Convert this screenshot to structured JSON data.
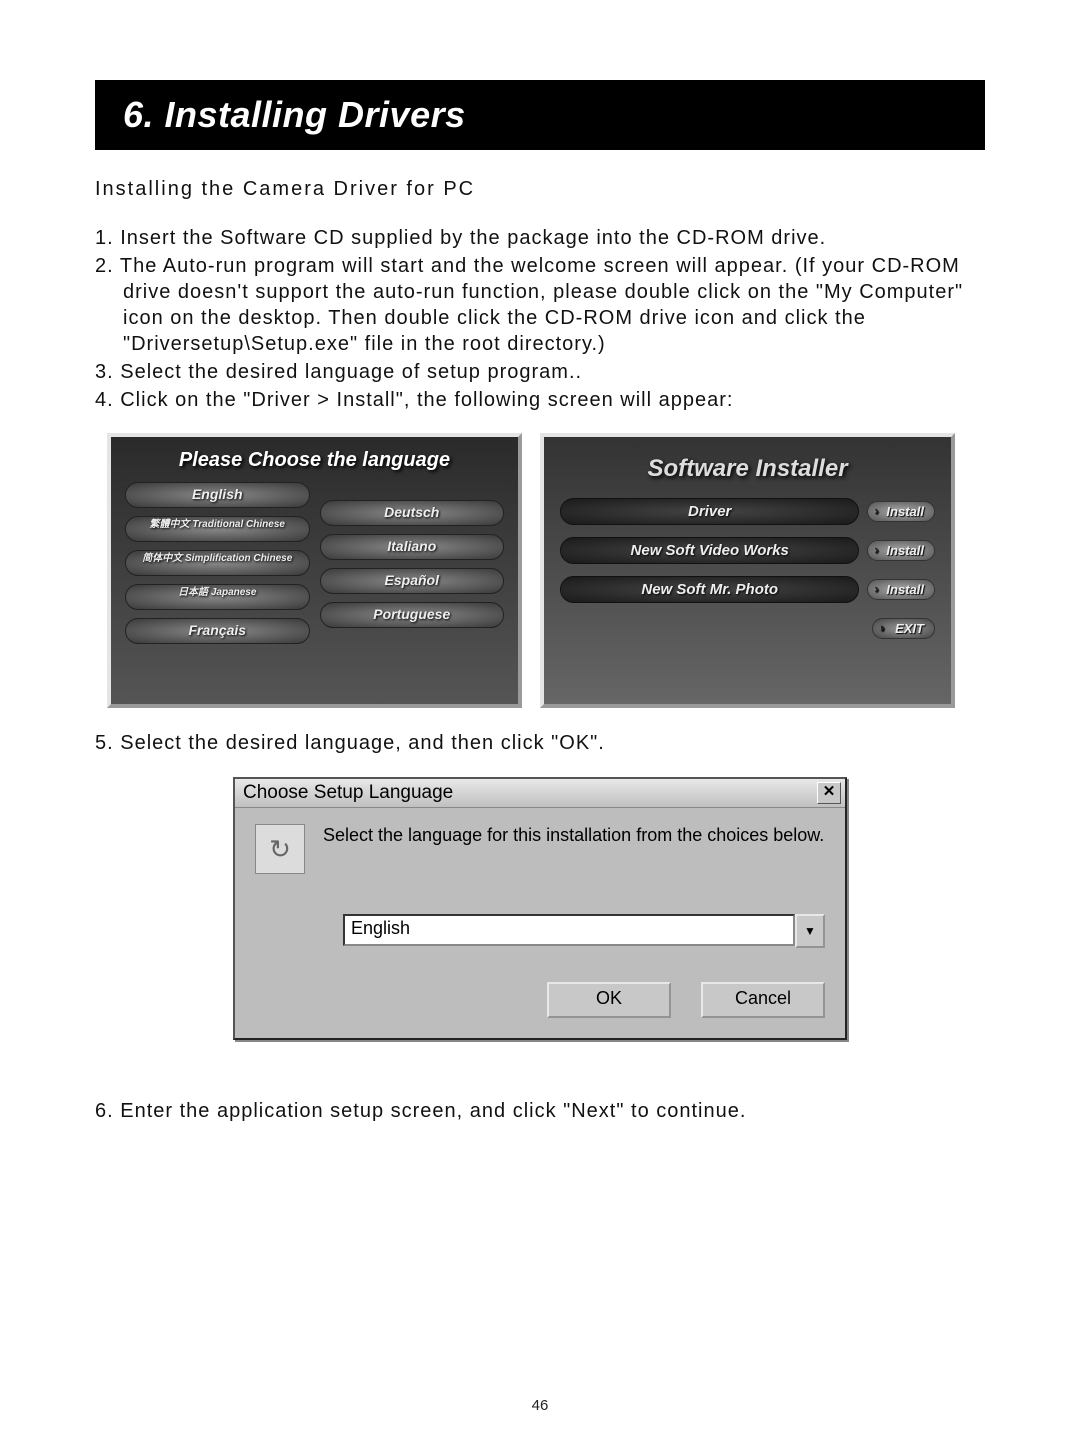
{
  "title": "6. Installing Drivers",
  "subheading": "Installing the Camera Driver for PC",
  "steps_1_4": [
    "1. Insert the Software CD supplied by the package into the CD-ROM drive.",
    "2. The Auto-run program will start and the welcome screen will appear. (If your CD-ROM drive doesn't support the auto-run function, please double click on the \"My Computer\" icon on the desktop. Then double click the CD-ROM drive icon and click the \"Driversetup\\Setup.exe\" file in the root directory.)",
    "3. Select the desired language of setup program..",
    "4. Click on the \"Driver > Install\", the following screen will appear:"
  ],
  "lang_screen": {
    "title": "Please Choose the language",
    "left": [
      {
        "main": "English"
      },
      {
        "main": "繁體中文",
        "sub": "Traditional Chinese"
      },
      {
        "main": "简体中文",
        "sub": "Simplification Chinese"
      },
      {
        "main": "日本語",
        "sub": "Japanese"
      },
      {
        "main": "Français"
      }
    ],
    "right": [
      {
        "main": "Deutsch"
      },
      {
        "main": "Italiano"
      },
      {
        "main": "Español"
      },
      {
        "main": "Portuguese"
      }
    ]
  },
  "installer_screen": {
    "title": "Software Installer",
    "rows": [
      {
        "label": "Driver",
        "btn": "Install"
      },
      {
        "label": "New Soft Video Works",
        "btn": "Install"
      },
      {
        "label": "New Soft Mr. Photo",
        "btn": "Install"
      }
    ],
    "exit": "EXIT"
  },
  "step5": "5. Select the desired language, and then click \"OK\".",
  "dialog": {
    "title": "Choose Setup Language",
    "close": "✕",
    "icon": "↻",
    "text": "Select the language for this installation from the choices below.",
    "select_value": "English",
    "dropdown_glyph": "▼",
    "ok": "OK",
    "cancel": "Cancel"
  },
  "step6": "6. Enter the application setup screen, and click \"Next\" to continue.",
  "page_number": "46"
}
